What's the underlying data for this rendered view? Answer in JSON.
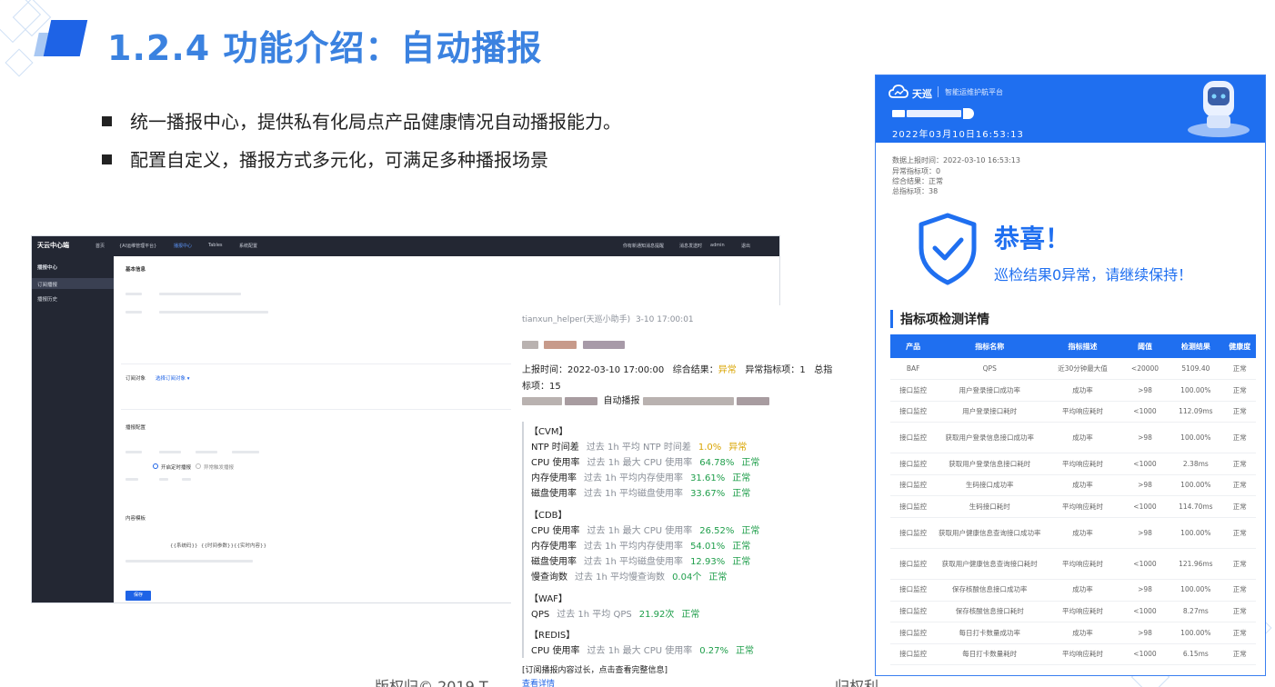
{
  "slide": {
    "title": "1.2.4 功能介绍：自动播报",
    "bullets": [
      "统一播报中心，提供私有化局点产品健康情况自动播报能力。",
      "配置自定义，播报方式多元化，可满足多种播报场景"
    ],
    "footer_left": "版权归© 2019 T",
    "footer_right": "归权利"
  },
  "config_shot": {
    "logo": "天云中心端",
    "nav": [
      "首页",
      "{AI运维管理平台}",
      "播报中心",
      "Tables",
      "系统配置"
    ],
    "top_right": [
      "你有新通知消息提醒",
      "消息发送时",
      "admin",
      "退出"
    ],
    "side_title": "播报中心",
    "side_items": [
      "订阅播报",
      "播报历史"
    ],
    "section_basic": "基本信息",
    "section_receive": "订阅对象",
    "section_receive_link": "选择订阅对象 ▾",
    "section_channel": "播报配置",
    "section_content": "内容模板",
    "radio_1": "开启定时播报",
    "radio_2": "异常触发播报",
    "template_tokens": [
      "{{系统码}}",
      "{{时间参数}}",
      "{{实时内容}}"
    ],
    "save_button": "保存"
  },
  "chat": {
    "sender": "tianxun_helper(天巡小助手)",
    "time": "3-10 17:00:01",
    "report_time_label": "上报时间：",
    "report_time": "2022-03-10 17:00:00",
    "overall_label": "综合结果：",
    "overall_value": "异常",
    "abnormal_label": "异常指标项：",
    "abnormal_value": "1",
    "total_label": "总指",
    "total_label2": "标项：",
    "total_value": "15",
    "auto_label": "自动播报",
    "groups": [
      {
        "name": "【CVM】",
        "rows": [
          {
            "metric": "NTP 时间差",
            "desc": "过去 1h 平均 NTP 时间差",
            "value": "1.0%",
            "status": "异常",
            "warn": true
          },
          {
            "metric": "CPU 使用率",
            "desc": "过去 1h 最大 CPU 使用率",
            "value": "64.78%",
            "status": "正常",
            "warn": false
          },
          {
            "metric": "内存使用率",
            "desc": "过去 1h 平均内存使用率",
            "value": "31.61%",
            "status": "正常",
            "warn": false
          },
          {
            "metric": "磁盘使用率",
            "desc": "过去 1h 平均磁盘使用率",
            "value": "33.67%",
            "status": "正常",
            "warn": false
          }
        ]
      },
      {
        "name": "【CDB】",
        "rows": [
          {
            "metric": "CPU 使用率",
            "desc": "过去 1h 最大 CPU 使用率",
            "value": "26.52%",
            "status": "正常",
            "warn": false
          },
          {
            "metric": "内存使用率",
            "desc": "过去 1h 平均内存使用率",
            "value": "54.01%",
            "status": "正常",
            "warn": false
          },
          {
            "metric": "磁盘使用率",
            "desc": "过去 1h 平均磁盘使用率",
            "value": "12.93%",
            "status": "正常",
            "warn": false
          },
          {
            "metric": "慢查询数",
            "desc": "过去 1h 平均慢查询数",
            "value": "0.04个",
            "status": "正常",
            "warn": false
          }
        ]
      },
      {
        "name": "【WAF】",
        "rows": [
          {
            "metric": "QPS",
            "desc": "过去 1h 平均 QPS",
            "value": "21.92次",
            "status": "正常",
            "warn": false
          }
        ]
      },
      {
        "name": "【REDIS】",
        "rows": [
          {
            "metric": "CPU 使用率",
            "desc": "过去 1h 最大 CPU 使用率",
            "value": "0.27%",
            "status": "正常",
            "warn": false
          }
        ]
      }
    ],
    "footer_note": "[订阅播报内容过长，点击查看完整信息]",
    "footer_link": "查看详情"
  },
  "report": {
    "brand": "天巡",
    "platform": "智能运维护航平台",
    "datetime": "2022年03月10日16:53:13",
    "meta": [
      "数据上报时间：2022-03-10 16:53:13",
      "异常指标项：0",
      "综合结果：正常",
      "总指标项：38"
    ],
    "congrats": "恭喜！",
    "congrats_sub": "巡检结果0异常，请继续保持！",
    "detail_title": "指标项检测详情",
    "columns": [
      "产品",
      "指标名称",
      "指标描述",
      "阈值",
      "检测结果",
      "健康度"
    ],
    "rows": [
      [
        "BAF",
        "QPS",
        "近30分钟最大值",
        "<20000",
        "5109.40",
        "正常"
      ],
      [
        "接口监控",
        "用户登录接口成功率",
        "成功率",
        ">98",
        "100.00%",
        "正常"
      ],
      [
        "接口监控",
        "用户登录接口耗时",
        "平均响应耗时",
        "<1000",
        "112.09ms",
        "正常"
      ],
      [
        "接口监控",
        "获取用户登录信息接口成功率",
        "成功率",
        ">98",
        "100.00%",
        "正常"
      ],
      [
        "接口监控",
        "获取用户登录信息接口耗时",
        "平均响应耗时",
        "<1000",
        "2.38ms",
        "正常"
      ],
      [
        "接口监控",
        "生码接口成功率",
        "成功率",
        ">98",
        "100.00%",
        "正常"
      ],
      [
        "接口监控",
        "生码接口耗时",
        "平均响应耗时",
        "<1000",
        "114.70ms",
        "正常"
      ],
      [
        "接口监控",
        "获取用户健康信息查询接口成功率",
        "成功率",
        ">98",
        "100.00%",
        "正常"
      ],
      [
        "接口监控",
        "获取用户健康信息查询接口耗时",
        "平均响应耗时",
        "<1000",
        "121.96ms",
        "正常"
      ],
      [
        "接口监控",
        "保存核酸信息接口成功率",
        "成功率",
        ">98",
        "100.00%",
        "正常"
      ],
      [
        "接口监控",
        "保存核酸信息接口耗时",
        "平均响应耗时",
        "<1000",
        "8.27ms",
        "正常"
      ],
      [
        "接口监控",
        "每日打卡数量成功率",
        "成功率",
        ">98",
        "100.00%",
        "正常"
      ],
      [
        "接口监控",
        "每日打卡数量耗时",
        "平均响应耗时",
        "<1000",
        "6.15ms",
        "正常"
      ]
    ]
  },
  "colors": {
    "accent": "#1f6ff0",
    "title": "#3b82e0",
    "ok": "#1e9e4a",
    "warn": "#d9a400"
  }
}
